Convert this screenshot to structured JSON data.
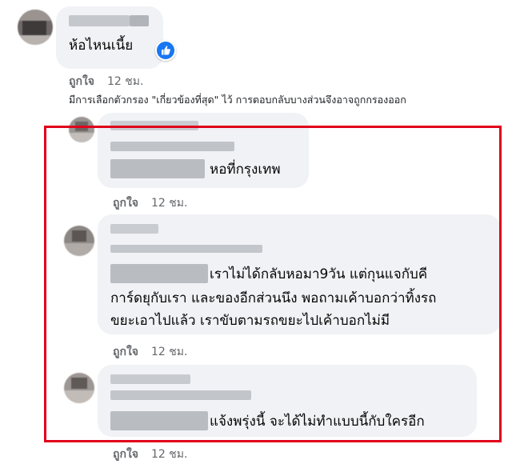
{
  "top_comment": {
    "text": "ห้อไหนเนี้ย",
    "like_label": "ถูกใจ",
    "time": "12 ชม.",
    "reaction_icon": "thumbs-up-icon"
  },
  "filter_notice": "มีการเลือกตัวกรอง \"เกี่ยวข้องที่สุด\" ไว้ การตอบกลับบางส่วนจึงอาจถูกกรองออก",
  "replies": [
    {
      "text": "หอที่กรุงเทพ",
      "like_label": "ถูกใจ",
      "time": "12 ชม."
    },
    {
      "lines": [
        "เราไม่ได้กลับหอมา9วัน แต่กุนแจกับคี",
        "การ์ดยุกับเรา และของอีกส่วนนึง พอถามเค้าบอกว่าทิ้งรถ",
        "ขยะเอาไปแล้ว เราขับตามรถขยะไปเค้าบอกไม่มี"
      ],
      "like_label": "ถูกใจ",
      "time": "12 ชม."
    },
    {
      "text": "แจ้งพรุ่งนี้ จะได้ไม่ทำแบบนี้กับใครอีก",
      "like_label": "ถูกใจ",
      "time": "12 ชม."
    }
  ],
  "bottom_meta": {
    "like_label": "ถูกใจ",
    "time": "12 ชม."
  },
  "colors": {
    "highlight": "#e0001b",
    "bubble": "#f0f2f5",
    "like_badge": "#1877f2",
    "meta_text": "#65676b"
  }
}
